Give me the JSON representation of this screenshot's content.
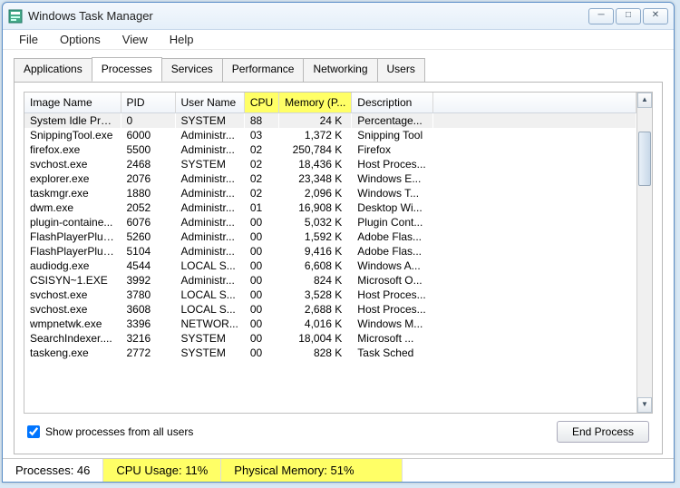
{
  "window": {
    "title": "Windows Task Manager"
  },
  "menu": {
    "file": "File",
    "options": "Options",
    "view": "View",
    "help": "Help"
  },
  "tabs": {
    "applications": "Applications",
    "processes": "Processes",
    "services": "Services",
    "performance": "Performance",
    "networking": "Networking",
    "users": "Users"
  },
  "columns": {
    "image": "Image Name",
    "pid": "PID",
    "user": "User Name",
    "cpu": "CPU",
    "mem": "Memory (P...",
    "desc": "Description"
  },
  "rows": [
    {
      "img": "System Idle Pro...",
      "pid": "0",
      "user": "SYSTEM",
      "cpu": "88",
      "mem": "24 K",
      "desc": "Percentage...",
      "sel": true
    },
    {
      "img": "SnippingTool.exe",
      "pid": "6000",
      "user": "Administr...",
      "cpu": "03",
      "mem": "1,372 K",
      "desc": "Snipping Tool"
    },
    {
      "img": "firefox.exe",
      "pid": "5500",
      "user": "Administr...",
      "cpu": "02",
      "mem": "250,784 K",
      "desc": "Firefox"
    },
    {
      "img": "svchost.exe",
      "pid": "2468",
      "user": "SYSTEM",
      "cpu": "02",
      "mem": "18,436 K",
      "desc": "Host Proces..."
    },
    {
      "img": "explorer.exe",
      "pid": "2076",
      "user": "Administr...",
      "cpu": "02",
      "mem": "23,348 K",
      "desc": "Windows E..."
    },
    {
      "img": "taskmgr.exe",
      "pid": "1880",
      "user": "Administr...",
      "cpu": "02",
      "mem": "2,096 K",
      "desc": "Windows T..."
    },
    {
      "img": "dwm.exe",
      "pid": "2052",
      "user": "Administr...",
      "cpu": "01",
      "mem": "16,908 K",
      "desc": "Desktop Wi..."
    },
    {
      "img": "plugin-containe...",
      "pid": "6076",
      "user": "Administr...",
      "cpu": "00",
      "mem": "5,032 K",
      "desc": "Plugin Cont..."
    },
    {
      "img": "FlashPlayerPlug...",
      "pid": "5260",
      "user": "Administr...",
      "cpu": "00",
      "mem": "1,592 K",
      "desc": "Adobe Flas..."
    },
    {
      "img": "FlashPlayerPlug...",
      "pid": "5104",
      "user": "Administr...",
      "cpu": "00",
      "mem": "9,416 K",
      "desc": "Adobe Flas..."
    },
    {
      "img": "audiodg.exe",
      "pid": "4544",
      "user": "LOCAL S...",
      "cpu": "00",
      "mem": "6,608 K",
      "desc": "Windows A..."
    },
    {
      "img": "CSISYN~1.EXE",
      "pid": "3992",
      "user": "Administr...",
      "cpu": "00",
      "mem": "824 K",
      "desc": "Microsoft O..."
    },
    {
      "img": "svchost.exe",
      "pid": "3780",
      "user": "LOCAL S...",
      "cpu": "00",
      "mem": "3,528 K",
      "desc": "Host Proces..."
    },
    {
      "img": "svchost.exe",
      "pid": "3608",
      "user": "LOCAL S...",
      "cpu": "00",
      "mem": "2,688 K",
      "desc": "Host Proces..."
    },
    {
      "img": "wmpnetwk.exe",
      "pid": "3396",
      "user": "NETWOR...",
      "cpu": "00",
      "mem": "4,016 K",
      "desc": "Windows M..."
    },
    {
      "img": "SearchIndexer....",
      "pid": "3216",
      "user": "SYSTEM",
      "cpu": "00",
      "mem": "18,004 K",
      "desc": "Microsoft ..."
    },
    {
      "img": "taskeng.exe",
      "pid": "2772",
      "user": "SYSTEM",
      "cpu": "00",
      "mem": "828 K",
      "desc": "Task Sched"
    }
  ],
  "footer": {
    "checkbox_label": "Show processes from all users",
    "end_process": "End Process"
  },
  "status": {
    "processes": "Processes: 46",
    "cpu": "CPU Usage: 11%",
    "mem": "Physical Memory: 51%"
  }
}
